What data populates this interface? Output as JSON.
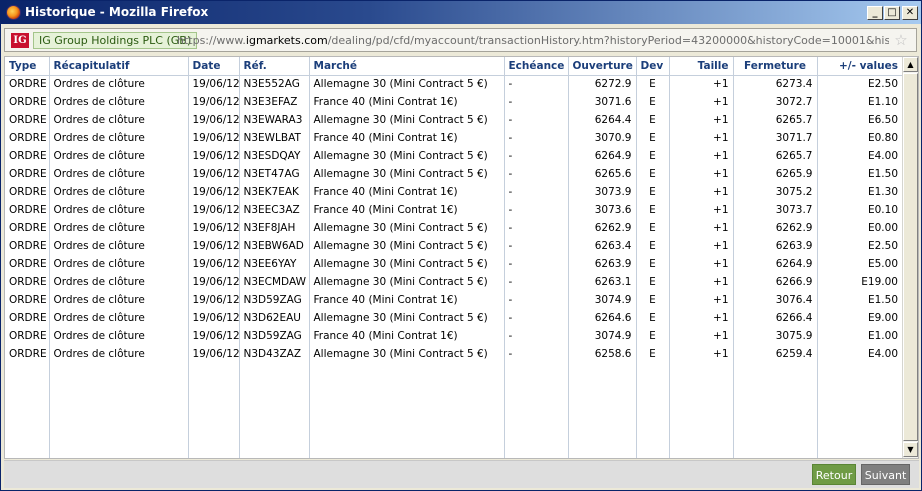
{
  "window": {
    "title": "Historique - Mozilla Firefox",
    "buttons": {
      "minimize": "_",
      "maximize": "□",
      "close": "✕"
    }
  },
  "addressbar": {
    "logo_text": "IG",
    "site_identity": "IG Group Holdings PLC (GB)",
    "url_prefix": "https://www.",
    "url_domain": "igmarkets.com",
    "url_rest": "/dealing/pd/cfd/myaccount/transactionHistory.htm?historyPeriod=43200000&historyCode=10001&historyDateFrom=TC"
  },
  "table": {
    "columns": [
      "Type",
      "Récapitulatif",
      "Date",
      "Réf.",
      "Marché",
      "Echéance",
      "Ouverture",
      "Dev",
      "Taille",
      "Fermeture",
      "+/- values"
    ],
    "rows": [
      [
        "ORDRE",
        "Ordres de clôture",
        "19/06/12",
        "N3E552AG",
        "Allemagne 30 (Mini Contract 5 €)",
        "-",
        "6272.9",
        "E",
        "+1",
        "6273.4",
        "E2.50"
      ],
      [
        "ORDRE",
        "Ordres de clôture",
        "19/06/12",
        "N3E3EFAZ",
        "France 40 (Mini Contrat 1€)",
        "-",
        "3071.6",
        "E",
        "+1",
        "3072.7",
        "E1.10"
      ],
      [
        "ORDRE",
        "Ordres de clôture",
        "19/06/12",
        "N3EWARA3",
        "Allemagne 30 (Mini Contract 5 €)",
        "-",
        "6264.4",
        "E",
        "+1",
        "6265.7",
        "E6.50"
      ],
      [
        "ORDRE",
        "Ordres de clôture",
        "19/06/12",
        "N3EWLBAT",
        "France 40 (Mini Contrat 1€)",
        "-",
        "3070.9",
        "E",
        "+1",
        "3071.7",
        "E0.80"
      ],
      [
        "ORDRE",
        "Ordres de clôture",
        "19/06/12",
        "N3ESDQAY",
        "Allemagne 30 (Mini Contract 5 €)",
        "-",
        "6264.9",
        "E",
        "+1",
        "6265.7",
        "E4.00"
      ],
      [
        "ORDRE",
        "Ordres de clôture",
        "19/06/12",
        "N3ET47AG",
        "Allemagne 30 (Mini Contract 5 €)",
        "-",
        "6265.6",
        "E",
        "+1",
        "6265.9",
        "E1.50"
      ],
      [
        "ORDRE",
        "Ordres de clôture",
        "19/06/12",
        "N3EK7EAK",
        "France 40 (Mini Contrat 1€)",
        "-",
        "3073.9",
        "E",
        "+1",
        "3075.2",
        "E1.30"
      ],
      [
        "ORDRE",
        "Ordres de clôture",
        "19/06/12",
        "N3EEC3AZ",
        "France 40 (Mini Contrat 1€)",
        "-",
        "3073.6",
        "E",
        "+1",
        "3073.7",
        "E0.10"
      ],
      [
        "ORDRE",
        "Ordres de clôture",
        "19/06/12",
        "N3EF8JAH",
        "Allemagne 30 (Mini Contract 5 €)",
        "-",
        "6262.9",
        "E",
        "+1",
        "6262.9",
        "E0.00"
      ],
      [
        "ORDRE",
        "Ordres de clôture",
        "19/06/12",
        "N3EBW6AD",
        "Allemagne 30 (Mini Contract 5 €)",
        "-",
        "6263.4",
        "E",
        "+1",
        "6263.9",
        "E2.50"
      ],
      [
        "ORDRE",
        "Ordres de clôture",
        "19/06/12",
        "N3EE6YAY",
        "Allemagne 30 (Mini Contract 5 €)",
        "-",
        "6263.9",
        "E",
        "+1",
        "6264.9",
        "E5.00"
      ],
      [
        "ORDRE",
        "Ordres de clôture",
        "19/06/12",
        "N3ECMDAW",
        "Allemagne 30 (Mini Contract 5 €)",
        "-",
        "6263.1",
        "E",
        "+1",
        "6266.9",
        "E19.00"
      ],
      [
        "ORDRE",
        "Ordres de clôture",
        "19/06/12",
        "N3D59ZAG",
        "France 40 (Mini Contrat 1€)",
        "-",
        "3074.9",
        "E",
        "+1",
        "3076.4",
        "E1.50"
      ],
      [
        "ORDRE",
        "Ordres de clôture",
        "19/06/12",
        "N3D62EAU",
        "Allemagne 30 (Mini Contract 5 €)",
        "-",
        "6264.6",
        "E",
        "+1",
        "6266.4",
        "E9.00"
      ],
      [
        "ORDRE",
        "Ordres de clôture",
        "19/06/12",
        "N3D59ZAG",
        "France 40 (Mini Contrat 1€)",
        "-",
        "3074.9",
        "E",
        "+1",
        "3075.9",
        "E1.00"
      ],
      [
        "ORDRE",
        "Ordres de clôture",
        "19/06/12",
        "N3D43ZAZ",
        "Allemagne 30 (Mini Contract 5 €)",
        "-",
        "6258.6",
        "E",
        "+1",
        "6259.4",
        "E4.00"
      ]
    ]
  },
  "footer": {
    "retour_label": "Retour",
    "suivant_label": "Suivant"
  }
}
